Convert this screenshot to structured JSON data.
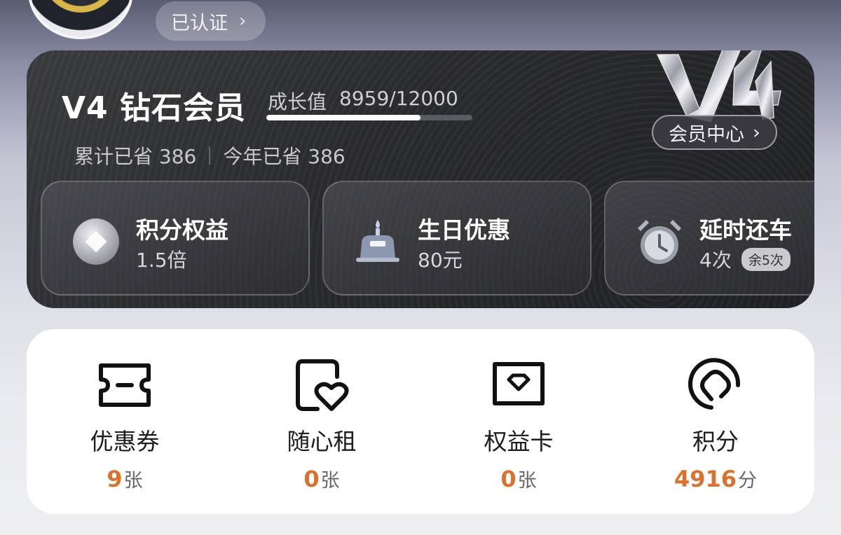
{
  "profile": {
    "verified_label": "已认证"
  },
  "member": {
    "level_title": "V4 钻石会员",
    "growth_label": "成长值",
    "growth_value": "8959/12000",
    "growth_progress": 0.747,
    "saved_total": "累计已省 386",
    "saved_year": "今年已省 386",
    "center_button": "会员中心",
    "badge_text": "V4"
  },
  "benefits": [
    {
      "name": "积分权益",
      "value": "1.5倍",
      "tag": "",
      "icon": "points-diamond-icon"
    },
    {
      "name": "生日优惠",
      "value": "80元",
      "tag": "",
      "icon": "birthday-cake-icon"
    },
    {
      "name": "延时还车",
      "value": "4次",
      "tag": "余5次",
      "icon": "alarm-clock-icon"
    }
  ],
  "assets": [
    {
      "label": "优惠券",
      "count": "9",
      "unit": "张",
      "icon": "coupon-icon"
    },
    {
      "label": "随心租",
      "count": "0",
      "unit": "张",
      "icon": "heart-card-icon"
    },
    {
      "label": "权益卡",
      "count": "0",
      "unit": "张",
      "icon": "benefit-card-icon"
    },
    {
      "label": "积分",
      "count": "4916",
      "unit": "分",
      "icon": "points-icon"
    }
  ],
  "colors": {
    "accent": "#d9722e",
    "card_dark": "#2a2b2e"
  }
}
